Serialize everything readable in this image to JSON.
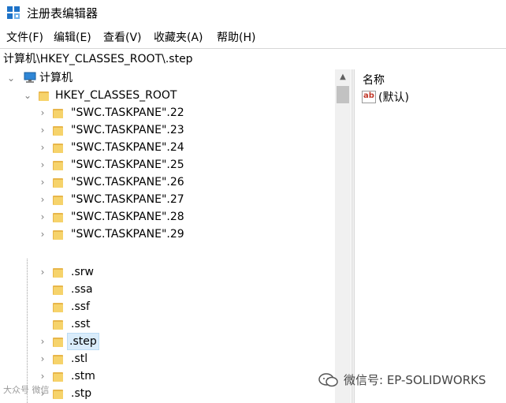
{
  "window": {
    "title": "注册表编辑器"
  },
  "menu": [
    "文件(F)",
    "编辑(E)",
    "查看(V)",
    "收藏夹(A)",
    "帮助(H)"
  ],
  "address": "计算机\\HKEY_CLASSES_ROOT\\.step",
  "tree": {
    "root": "计算机",
    "hive": "HKEY_CLASSES_ROOT",
    "keys": [
      "\"SWC.TASKPANE\".22",
      "\"SWC.TASKPANE\".23",
      "\"SWC.TASKPANE\".24",
      "\"SWC.TASKPANE\".25",
      "\"SWC.TASKPANE\".26",
      "\"SWC.TASKPANE\".27",
      "\"SWC.TASKPANE\".28",
      "\"SWC.TASKPANE\".29",
      ".srw",
      ".ssa",
      ".ssf",
      ".sst",
      ".step",
      ".stl",
      ".stm",
      ".stp"
    ],
    "selected": ".step"
  },
  "values": {
    "column_name": "名称",
    "items": [
      "(默认)"
    ],
    "icon": "ab-string-value-icon"
  },
  "watermark": {
    "text": "微信号: EP-SOLIDWORKS",
    "corner": "大众号 微信"
  },
  "colors": {
    "selection": "#d9ecfb",
    "folder": "#f6d36b",
    "app_icon": "#1e73c8"
  }
}
